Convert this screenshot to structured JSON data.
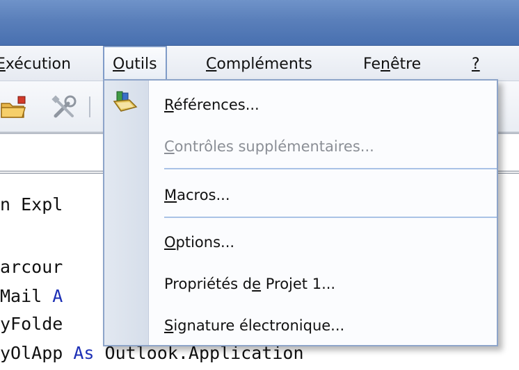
{
  "menubar": {
    "items": [
      {
        "label": "Exécution",
        "underline_index": 0
      },
      {
        "label": "Outils",
        "underline_index": 0
      },
      {
        "label": "Compléments",
        "underline_index": 0
      },
      {
        "label": "Fenêtre",
        "underline_index": 2
      },
      {
        "label": "?",
        "underline_index": 0
      }
    ]
  },
  "toolbar": {
    "icons": [
      "project-folder-icon",
      "tools-icon"
    ]
  },
  "code": {
    "lines": [
      {
        "text": "n Expl",
        "keyword": ""
      },
      {
        "text": "arcour",
        "keyword": ""
      },
      {
        "text": "Mail ",
        "keyword": "A"
      },
      {
        "text": "yFolde",
        "keyword": ""
      },
      {
        "text": "yOlApp ",
        "keyword": "As",
        "rest": " Outlook.Application"
      }
    ]
  },
  "dropdown": {
    "items": [
      {
        "label": "Références...",
        "underline_index": 0,
        "disabled": false,
        "icon": "references-icon"
      },
      {
        "label": "Contrôles supplémentaires...",
        "underline_index": 0,
        "disabled": true
      },
      {
        "label": "Macros...",
        "underline_index": 0,
        "disabled": false
      },
      {
        "label": "Options...",
        "underline_index": 0,
        "disabled": false
      },
      {
        "label": "Propriétés de Projet 1...",
        "underline_index": 12,
        "disabled": false
      },
      {
        "label": "Signature électronique...",
        "underline_index": 0,
        "disabled": false
      }
    ]
  },
  "colors": {
    "titlebar": "#5a7fba",
    "menu_highlight_border": "#7f9bc8",
    "keyword": "#1c2fb5",
    "disabled_text": "#8b8f96",
    "separator": "#a9c2e6"
  }
}
